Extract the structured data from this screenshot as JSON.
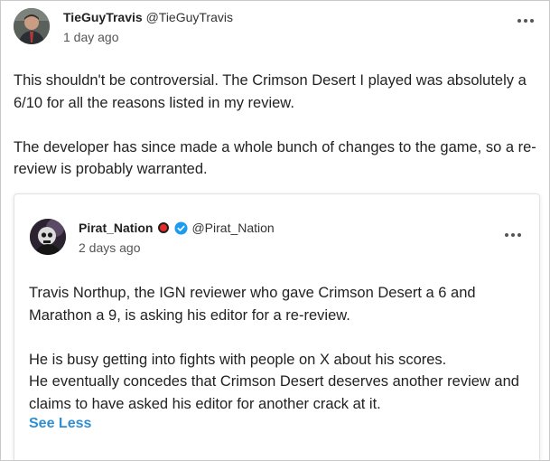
{
  "post": {
    "author_name": "TieGuyTravis",
    "author_handle": "@TieGuyTravis",
    "timestamp": "1 day ago",
    "avatar_icon": "user-avatar-icon",
    "more_icon": "more-options-icon",
    "paragraphs": [
      "This shouldn't be controversial. The Crimson Desert I played was absolutely a 6/10 for all the reasons listed in my review.",
      "The developer has since made a whole bunch of changes to the game, so a re-review is probably warranted."
    ]
  },
  "quote": {
    "author_name": "Pirat_Nation",
    "author_handle": "@Pirat_Nation",
    "timestamp": "2 days ago",
    "avatar_icon": "user-avatar-icon",
    "badge_icon": "red-dot-badge-icon",
    "verified_icon": "verified-check-icon",
    "more_icon": "more-options-icon",
    "paragraphs": [
      "Travis Northup, the IGN reviewer who gave Crimson Desert a 6 and Marathon a 9, is asking his editor for a re-review.",
      "He is busy getting into fights with people on X about his scores.\nHe eventually concedes that Crimson Desert deserves another review and claims to have asked his editor for another crack at it."
    ],
    "see_less_label": "See Less"
  },
  "colors": {
    "link": "#2f8fd0",
    "verified": "#1d9bf0",
    "red_badge": "#e52a2a",
    "text": "#222222",
    "muted": "#555555"
  }
}
